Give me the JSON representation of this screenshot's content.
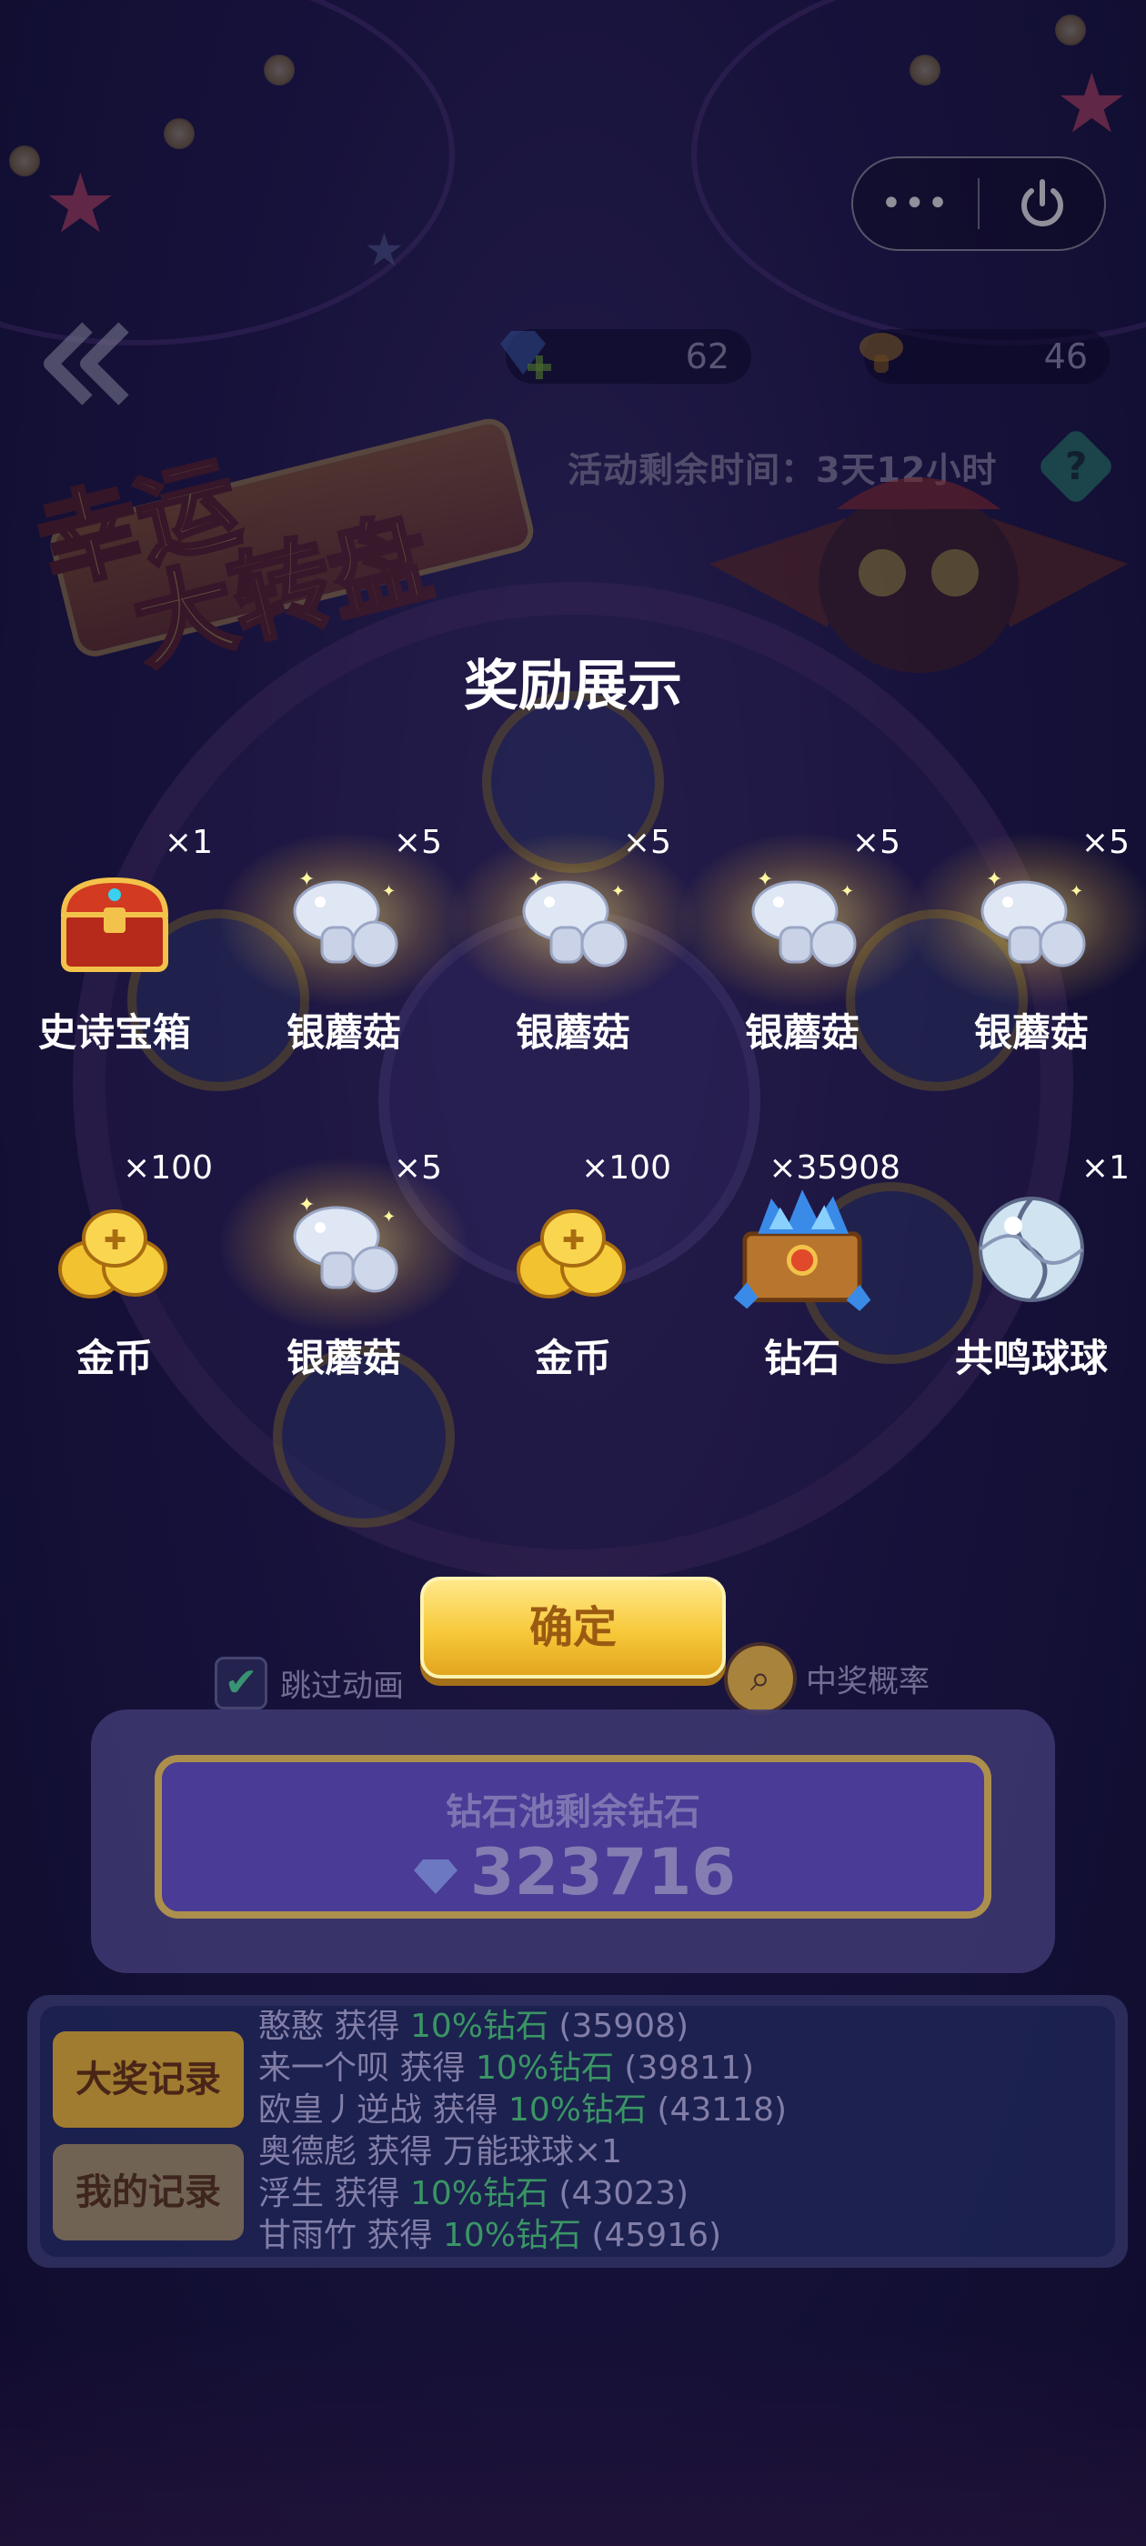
{
  "capsule": {
    "more_label": "•••",
    "close_label": "⏻"
  },
  "resources": {
    "diamonds": "62",
    "mushrooms": "46"
  },
  "event": {
    "timer": "活动剩余时间：3天12小时",
    "help": "?"
  },
  "logo": {
    "line1": "幸运",
    "line2": "大转盘"
  },
  "overlay": {
    "title": "奖励展示",
    "rewards": [
      {
        "name": "史诗宝箱",
        "qty": "×1",
        "icon": "treasure-chest-icon"
      },
      {
        "name": "银蘑菇",
        "qty": "×5",
        "icon": "silver-mushroom-icon"
      },
      {
        "name": "银蘑菇",
        "qty": "×5",
        "icon": "silver-mushroom-icon"
      },
      {
        "name": "银蘑菇",
        "qty": "×5",
        "icon": "silver-mushroom-icon"
      },
      {
        "name": "银蘑菇",
        "qty": "×5",
        "icon": "silver-mushroom-icon"
      },
      {
        "name": "金币",
        "qty": "×100",
        "icon": "gold-coins-icon"
      },
      {
        "name": "银蘑菇",
        "qty": "×5",
        "icon": "silver-mushroom-icon"
      },
      {
        "name": "金币",
        "qty": "×100",
        "icon": "gold-coins-icon"
      },
      {
        "name": "钻石",
        "qty": "×35908",
        "icon": "diamond-crate-icon"
      },
      {
        "name": "共鸣球球",
        "qty": "×1",
        "icon": "resonance-ball-icon"
      }
    ],
    "confirm_label": "确定"
  },
  "controls": {
    "skip_label": "跳过动画",
    "skip_checked": "✔",
    "probability_label": "中奖概率"
  },
  "pool": {
    "label": "钻石池剩余钻石",
    "amount": "323716"
  },
  "records": {
    "tab_grand": "大奖记录",
    "tab_mine": "我的记录",
    "entries": [
      {
        "user": "憨憨",
        "verb": "获得",
        "prize": "10%钻石",
        "amount": "(35908)"
      },
      {
        "user": "来一个呗",
        "verb": "获得",
        "prize": "10%钻石",
        "amount": "(39811)"
      },
      {
        "user": "欧皇丿逆战",
        "verb": "获得",
        "prize": "10%钻石",
        "amount": "(43118)"
      },
      {
        "user": "奥德彪",
        "verb": "获得",
        "prize": "万能球球×1",
        "amount": ""
      },
      {
        "user": "浮生",
        "verb": "获得",
        "prize": "10%钻石",
        "amount": "(43023)"
      },
      {
        "user": "甘雨竹",
        "verb": "获得",
        "prize": "10%钻石",
        "amount": "(45916)"
      }
    ]
  }
}
